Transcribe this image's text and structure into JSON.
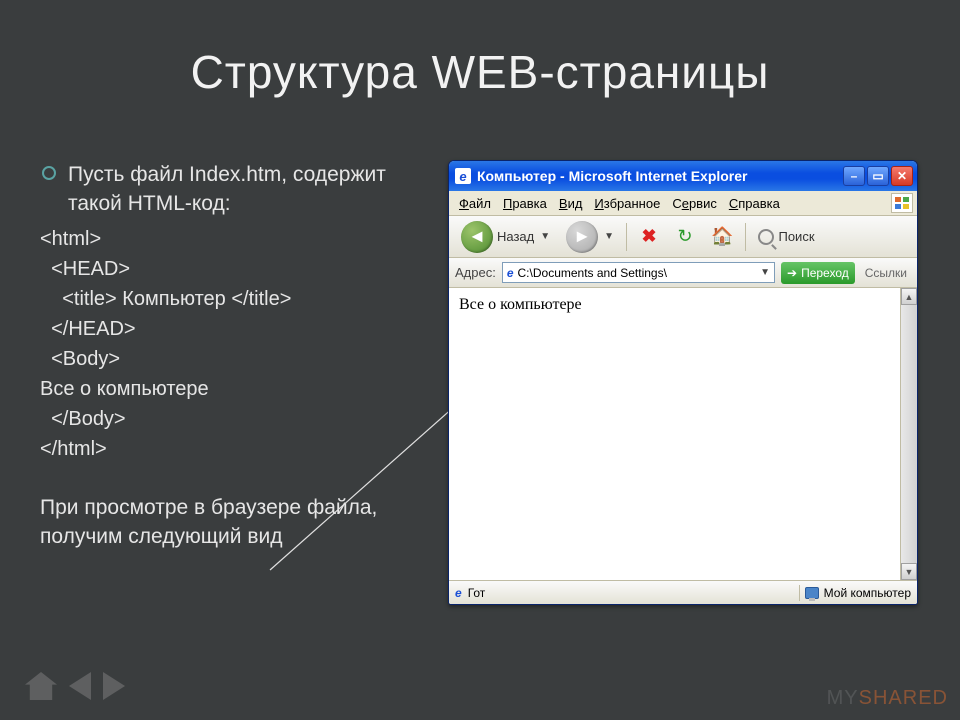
{
  "slide": {
    "title": "Структура WEB-страницы",
    "bullet": "Пусть  файл Index.htm, содержит такой HTML-код:",
    "code": {
      "l1": "<html>",
      "l2": "  <HEAD>",
      "l3": "    <title> Компьютер </title>",
      "l4": "  </HEAD>",
      "l5": "  <Body>",
      "l6": "Все о компьютере",
      "l7": "  </Body>",
      "l8": "</html>"
    },
    "footer": "При просмотре в браузере файла, получим следующий вид"
  },
  "ie": {
    "title": "Компьютер - Microsoft Internet Explorer",
    "menus": {
      "file": "Файл",
      "edit": "Правка",
      "view": "Вид",
      "fav": "Избранное",
      "tools": "Сервис",
      "help": "Справка"
    },
    "toolbar": {
      "back": "Назад",
      "search": "Поиск"
    },
    "address": {
      "label": "Адрес:",
      "path": "C:\\Documents and Settings\\",
      "go": "Переход",
      "links": "Ссылки"
    },
    "page_text": "Все о компьютере",
    "status": {
      "left": "Гот",
      "right": "Мой компьютер"
    }
  },
  "watermark": {
    "a": "MY",
    "b": "SHARED"
  }
}
